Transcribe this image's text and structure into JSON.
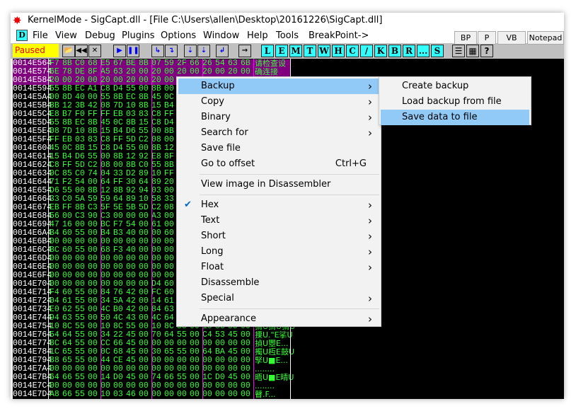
{
  "window": {
    "title": "KernelMode - SigCapt.dll - [File C:\\Users\\allen\\Desktop\\20161226\\SigCapt.dll]"
  },
  "menubar": {
    "app_icon": "D",
    "items": [
      "File",
      "View",
      "Debug",
      "Plugins",
      "Options",
      "Window",
      "Help",
      "Tools",
      "BreakPoint->"
    ]
  },
  "tabs": [
    "BP",
    "P",
    "VB",
    "Notepad"
  ],
  "toolbar": {
    "status": "Paused",
    "status_color": "#ffff00",
    "letter_buttons": [
      "L",
      "E",
      "M",
      "T",
      "W",
      "H",
      "C",
      "/",
      "K",
      "B",
      "R",
      "...",
      "S"
    ]
  },
  "hex": {
    "rows": [
      {
        "addr": "0014E564",
        "bytes": [
          "F7",
          "8B",
          "C0",
          "68",
          "E5",
          "67",
          "BE",
          "8B",
          "07",
          "59",
          "2F",
          "66",
          "26",
          "54",
          "63",
          "6B"
        ],
        "ascii": "请检查设",
        "selected": true
      },
      {
        "addr": "0014E574",
        "bytes": [
          "6E",
          "78",
          "DE",
          "8F",
          "A5",
          "63",
          "20",
          "00",
          "20",
          "00",
          "20",
          "00",
          "20",
          "00",
          "20",
          "00"
        ],
        "ascii": "确连接",
        "selected": true
      },
      {
        "addr": "0014E584",
        "bytes": [
          "20",
          "00",
          "20",
          "00",
          "20",
          "00",
          "20",
          "00",
          "20",
          "00"
        ],
        "ascii": "",
        "selected": true
      },
      {
        "addr": "0014E594",
        "bytes": [
          "55",
          "8B",
          "EC",
          "A1",
          "C8",
          "D4",
          "55",
          "00",
          "8B",
          "00"
        ]
      },
      {
        "addr": "0014E5A4",
        "bytes": [
          "00",
          "8D",
          "40",
          "00",
          "55",
          "8B",
          "EC",
          "8B",
          "45",
          "0C"
        ]
      },
      {
        "addr": "0014E5B4",
        "bytes": [
          "8B",
          "12",
          "3B",
          "42",
          "08",
          "7D",
          "10",
          "8B",
          "15",
          "B4"
        ]
      },
      {
        "addr": "0014E5C4",
        "bytes": [
          "E8",
          "B7",
          "F0",
          "FF",
          "FF",
          "EB",
          "03",
          "83",
          "C8",
          "FF"
        ]
      },
      {
        "addr": "0014E5D4",
        "bytes": [
          "55",
          "8B",
          "EC",
          "8B",
          "45",
          "0C",
          "8B",
          "15",
          "C8",
          "D4"
        ]
      },
      {
        "addr": "0014E5E4",
        "bytes": [
          "08",
          "7D",
          "10",
          "8B",
          "15",
          "B4",
          "D6",
          "55",
          "00",
          "8B"
        ]
      },
      {
        "addr": "0014E5F4",
        "bytes": [
          "FF",
          "EB",
          "03",
          "83",
          "C8",
          "FF",
          "5D",
          "C2",
          "08",
          "00"
        ]
      },
      {
        "addr": "0014E604",
        "bytes": [
          "45",
          "0C",
          "8B",
          "15",
          "C8",
          "D4",
          "55",
          "00",
          "8B",
          "12"
        ]
      },
      {
        "addr": "0014E614",
        "bytes": [
          "15",
          "B4",
          "D6",
          "55",
          "00",
          "8B",
          "12",
          "92",
          "E8",
          "8F"
        ]
      },
      {
        "addr": "0014E624",
        "bytes": [
          "C8",
          "FF",
          "5D",
          "C2",
          "08",
          "00",
          "8B",
          "C0",
          "55",
          "8B"
        ]
      },
      {
        "addr": "0014E634",
        "bytes": [
          "0C",
          "85",
          "C0",
          "74",
          "04",
          "33",
          "D2",
          "89",
          "10",
          "FF"
        ]
      },
      {
        "addr": "0014E644",
        "bytes": [
          "71",
          "F2",
          "54",
          "00",
          "64",
          "FF",
          "30",
          "64",
          "89",
          "20"
        ]
      },
      {
        "addr": "0014E654",
        "bytes": [
          "D6",
          "55",
          "00",
          "8B",
          "12",
          "8B",
          "92",
          "94",
          "03",
          "00"
        ]
      },
      {
        "addr": "0014E664",
        "bytes": [
          "33",
          "C0",
          "5A",
          "59",
          "59",
          "64",
          "89",
          "10",
          "58",
          "33"
        ]
      },
      {
        "addr": "0014E674",
        "bytes": [
          "EB",
          "FF",
          "8B",
          "C3",
          "5F",
          "5E",
          "5B",
          "5D",
          "C2",
          "08"
        ]
      },
      {
        "addr": "0014E684",
        "bytes": [
          "56",
          "00",
          "C3",
          "90",
          "C3",
          "00",
          "00",
          "00",
          "A3",
          "00"
        ]
      },
      {
        "addr": "0014E694",
        "bytes": [
          "47",
          "16",
          "00",
          "00",
          "BC",
          "F7",
          "54",
          "00",
          "61",
          "00"
        ]
      },
      {
        "addr": "0014E6A4",
        "bytes": [
          "B4",
          "60",
          "55",
          "00",
          "B4",
          "B3",
          "40",
          "00",
          "00",
          "60"
        ]
      },
      {
        "addr": "0014E6B4",
        "bytes": [
          "00",
          "00",
          "00",
          "00",
          "00",
          "00",
          "00",
          "00",
          "00",
          "00"
        ]
      },
      {
        "addr": "0014E6C4",
        "bytes": [
          "BC",
          "60",
          "55",
          "00",
          "68",
          "F3",
          "40",
          "00",
          "00",
          "00"
        ]
      },
      {
        "addr": "0014E6D4",
        "bytes": [
          "00",
          "00",
          "00",
          "00",
          "00",
          "00",
          "00",
          "00",
          "00",
          "00"
        ]
      },
      {
        "addr": "0014E6E4",
        "bytes": [
          "00",
          "00",
          "00",
          "00",
          "00",
          "00",
          "00",
          "00",
          "00",
          "00"
        ]
      },
      {
        "addr": "0014E6F4",
        "bytes": [
          "00",
          "00",
          "00",
          "00",
          "00",
          "00",
          "00",
          "00",
          "00",
          "00"
        ]
      },
      {
        "addr": "0014E704",
        "bytes": [
          "00",
          "00",
          "00",
          "00",
          "00",
          "00",
          "00",
          "00",
          "D4",
          "60"
        ]
      },
      {
        "addr": "0014E714",
        "bytes": [
          "F4",
          "60",
          "55",
          "00",
          "84",
          "76",
          "42",
          "00",
          "FC",
          "60"
        ]
      },
      {
        "addr": "0014E724",
        "bytes": [
          "04",
          "61",
          "55",
          "00",
          "34",
          "5A",
          "42",
          "00",
          "14",
          "61"
        ]
      },
      {
        "addr": "0014E734",
        "bytes": [
          "E0",
          "62",
          "55",
          "00",
          "4C",
          "B0",
          "42",
          "00",
          "84",
          "63"
        ]
      },
      {
        "addr": "0014E744",
        "bytes": [
          "94",
          "63",
          "55",
          "00",
          "50",
          "4C",
          "43",
          "00",
          "4C",
          "64"
        ]
      },
      {
        "addr": "0014E754",
        "bytes": [
          "10",
          "8C",
          "55",
          "00",
          "10",
          "8C",
          "55",
          "00",
          "10",
          "8C",
          "55",
          "00",
          "10",
          "8C",
          "55",
          "00"
        ],
        "ascii": "猬U猬U猬U"
      },
      {
        "addr": "0014E764",
        "bytes": [
          "54",
          "64",
          "55",
          "00",
          "34",
          "22",
          "45",
          "00",
          "70",
          "64",
          "55",
          "00",
          "C4",
          "53",
          "45",
          "00"
        ],
        "ascii": "搮U.\"E挲U"
      },
      {
        "addr": "0014E774",
        "bytes": [
          "8C",
          "64",
          "55",
          "00",
          "CC",
          "66",
          "45",
          "00",
          "00",
          "00",
          "00",
          "00",
          "00",
          "00",
          "00",
          "00"
        ],
        "ascii": "揁U瞾E..."
      },
      {
        "addr": "0014E784",
        "bytes": [
          "1C",
          "65",
          "55",
          "00",
          "0C",
          "68",
          "45",
          "00",
          "30",
          "65",
          "55",
          "00",
          "64",
          "BA",
          "45",
          "00"
        ],
        "ascii": "擉U枑E鼓U"
      },
      {
        "addr": "0014E794",
        "bytes": [
          "88",
          "65",
          "55",
          "00",
          "44",
          "CE",
          "45",
          "00",
          "00",
          "00",
          "00",
          "00",
          "00",
          "00",
          "00",
          "00"
        ],
        "ascii": "孯U■E..."
      },
      {
        "addr": "0014E7A4",
        "bytes": [
          "00",
          "00",
          "00",
          "00",
          "00",
          "00",
          "00",
          "00",
          "00",
          "00",
          "00",
          "00",
          "00",
          "00",
          "00",
          "00"
        ],
        "ascii": "........"
      },
      {
        "addr": "0014E7B4",
        "bytes": [
          "64",
          "66",
          "55",
          "00",
          "14",
          "D0",
          "45",
          "00",
          "74",
          "66",
          "55",
          "00",
          "1C",
          "D0",
          "45",
          "00"
        ],
        "ascii": "晤U■E晴U"
      },
      {
        "addr": "0014E7C4",
        "bytes": [
          "00",
          "00",
          "00",
          "00",
          "00",
          "00",
          "00",
          "00",
          "00",
          "00",
          "00",
          "00",
          "00",
          "00",
          "00",
          "00"
        ],
        "ascii": "........"
      },
      {
        "addr": "0014E7D4",
        "bytes": [
          "A8",
          "66",
          "55",
          "00",
          "10",
          "03",
          "46",
          "00",
          "00",
          "00",
          "00",
          "00",
          "00",
          "00",
          "00",
          "00"
        ],
        "ascii": "瞽.F..."
      }
    ]
  },
  "context_menu": {
    "items": [
      {
        "label": "Backup",
        "submenu": true,
        "highlighted": true
      },
      {
        "label": "Copy",
        "submenu": true
      },
      {
        "label": "Binary",
        "submenu": true
      },
      {
        "label": "Search for",
        "submenu": true
      },
      {
        "label": "Save file"
      },
      {
        "label": "Go to offset",
        "shortcut": "Ctrl+G"
      },
      {
        "separator": true
      },
      {
        "label": "View image in Disassembler"
      },
      {
        "separator": true
      },
      {
        "label": "Hex",
        "submenu": true,
        "checked": true
      },
      {
        "label": "Text",
        "submenu": true
      },
      {
        "label": "Short",
        "submenu": true
      },
      {
        "label": "Long",
        "submenu": true
      },
      {
        "label": "Float",
        "submenu": true
      },
      {
        "label": "Disassemble"
      },
      {
        "label": "Special",
        "submenu": true
      },
      {
        "separator": true
      },
      {
        "label": "Appearance",
        "submenu": true
      }
    ]
  },
  "submenu": {
    "items": [
      {
        "label": "Create backup"
      },
      {
        "label": "Load backup from file"
      },
      {
        "label": "Save data to file",
        "highlighted": true
      }
    ]
  }
}
